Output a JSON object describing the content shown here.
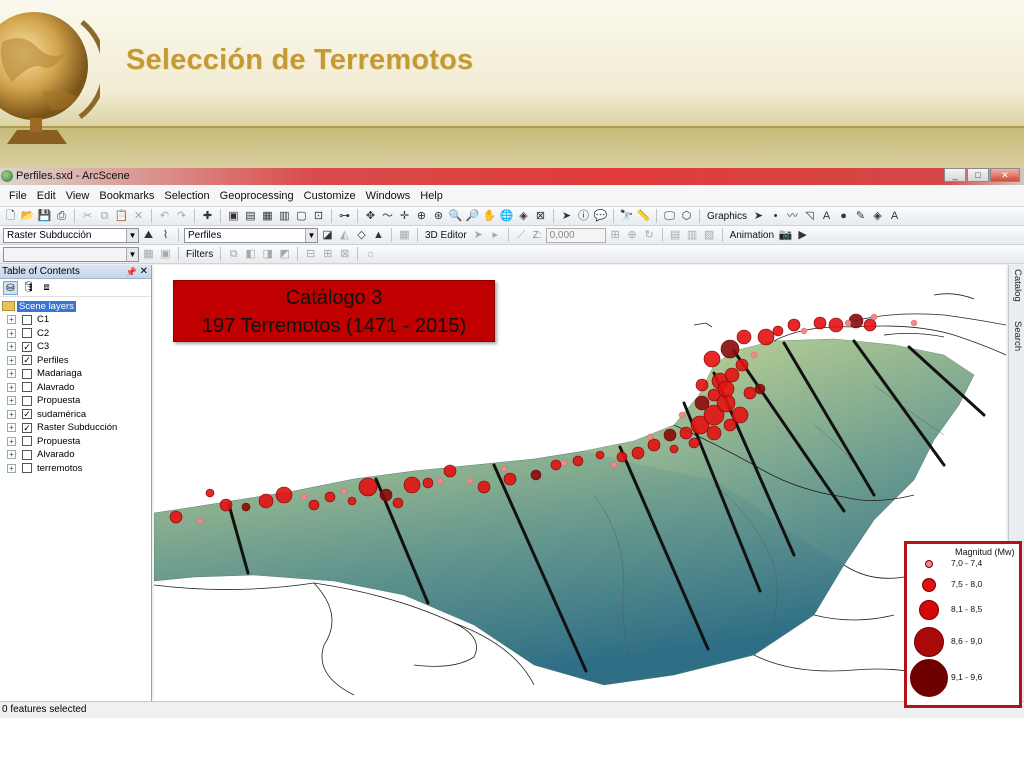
{
  "slide": {
    "title": "Selección de Terremotos"
  },
  "window": {
    "title": "Perfiles.sxd - ArcScene"
  },
  "menu": [
    "File",
    "Edit",
    "View",
    "Bookmarks",
    "Selection",
    "Geoprocessing",
    "Customize",
    "Windows",
    "Help"
  ],
  "toolbar": {
    "graphics_label": "Graphics",
    "layer_combo": "Raster Subducción",
    "target_combo": "Perfiles",
    "editor_label": "3D Editor",
    "z_label": "Z:",
    "z_value": "0,000",
    "animation_label": "Animation",
    "filters_label": "Filters"
  },
  "toc": {
    "title": "Table of Contents",
    "root": "Scene layers",
    "layers": [
      {
        "name": "C1",
        "checked": false
      },
      {
        "name": "C2",
        "checked": false
      },
      {
        "name": "C3",
        "checked": true
      },
      {
        "name": "Perfiles",
        "checked": true
      },
      {
        "name": "Madariaga",
        "checked": false
      },
      {
        "name": "Alavrado",
        "checked": false
      },
      {
        "name": "Propuesta",
        "checked": false
      },
      {
        "name": "sudamérica",
        "checked": true
      },
      {
        "name": "Raster Subducción",
        "checked": true
      },
      {
        "name": "Propuesta",
        "checked": false
      },
      {
        "name": "Alvarado",
        "checked": false
      },
      {
        "name": "terremotos",
        "checked": false
      }
    ]
  },
  "side_tabs": [
    "Catalog",
    "Search"
  ],
  "status": "0 features selected",
  "catalog_box": {
    "line1": "Catálogo 3",
    "line2": "197 Terremotos (1471 - 2015)"
  },
  "legend": {
    "title": "Magnitud (Mw)",
    "items": [
      "7,0 - 7,4",
      "7,5 - 8,0",
      "8,1 - 8,5",
      "8,6 - 9,0",
      "9,1 - 9,6"
    ],
    "colors": [
      "#f08a8a",
      "#e01010",
      "#d40808",
      "#a80a0a",
      "#6e0000"
    ]
  },
  "colors": {
    "title_gold": "#c59a36",
    "quake_red": "#e21212",
    "highlight_red": "#c00000"
  }
}
